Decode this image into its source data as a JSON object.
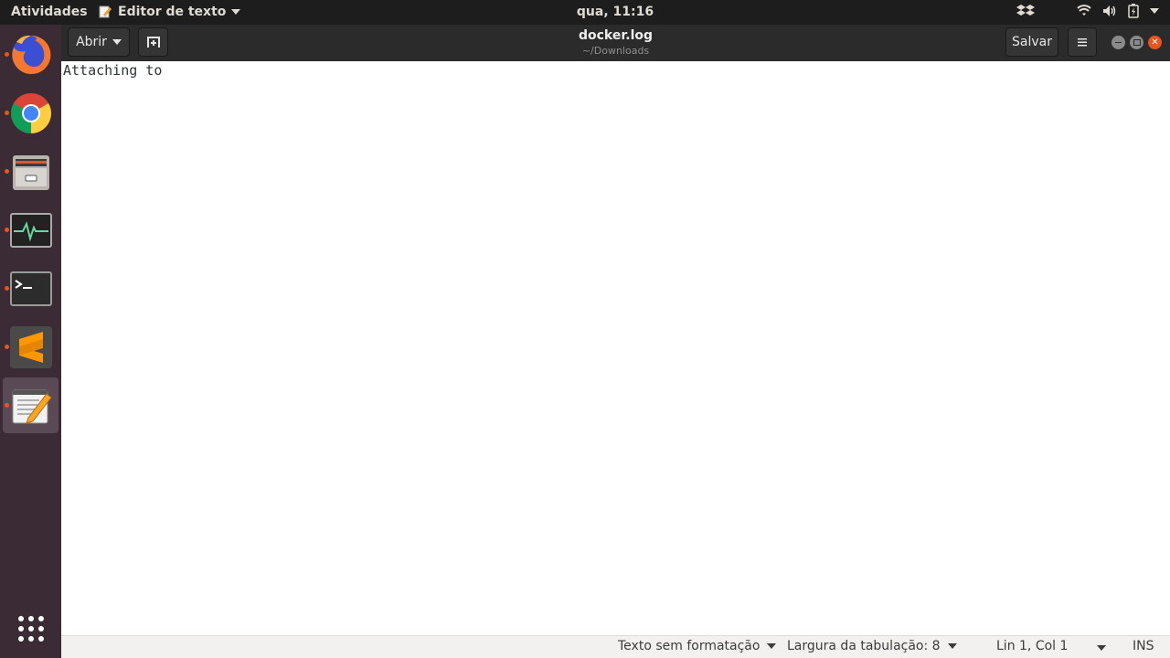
{
  "top_panel": {
    "activities": "Atividades",
    "app_menu": "Editor de texto",
    "clock": "qua, 11:16"
  },
  "dock": {
    "items": [
      {
        "name": "firefox-icon"
      },
      {
        "name": "chrome-icon"
      },
      {
        "name": "files-icon"
      },
      {
        "name": "system-monitor-icon"
      },
      {
        "name": "terminal-icon"
      },
      {
        "name": "sublime-text-icon"
      },
      {
        "name": "text-editor-icon"
      }
    ],
    "show_apps": "show-applications-icon"
  },
  "headerbar": {
    "open_label": "Abrir",
    "title": "docker.log",
    "path": "~/Downloads",
    "save_label": "Salvar"
  },
  "editor": {
    "content": "Attaching to"
  },
  "statusbar": {
    "syntax": "Texto sem formatação",
    "tab_width": "Largura da tabulação: 8",
    "position": "Lin 1, Col 1",
    "mode": "INS"
  },
  "colors": {
    "accent": "#e95420",
    "dock_bg": "#3b2b35",
    "panel_bg": "#1d1d1d",
    "header_bg": "#2b2b2b"
  }
}
